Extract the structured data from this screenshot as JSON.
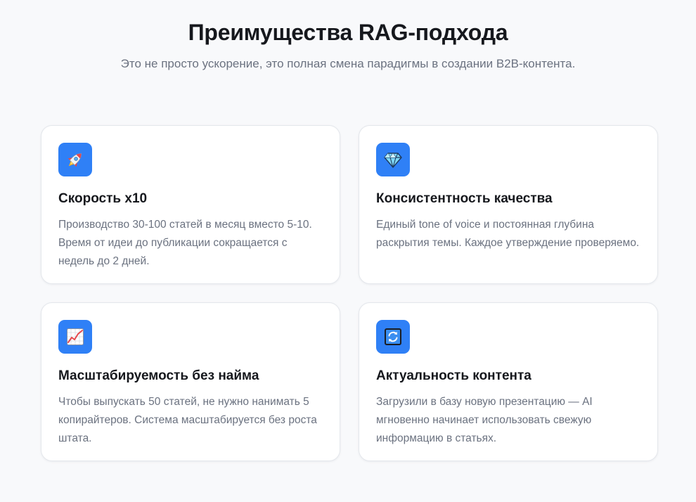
{
  "header": {
    "title": "Преимущества RAG-подхода",
    "subtitle": "Это не просто ускорение, это полная смена парадигмы в создании B2B-контента."
  },
  "colors": {
    "accent": "#2f80f6",
    "background": "#f8f9fb",
    "card": "#ffffff",
    "text_muted": "#6b7280"
  },
  "cards": [
    {
      "icon": "rocket-icon",
      "title": "Скорость x10",
      "text": "Производство 30-100 статей в месяц вместо 5-10. Время от идеи до публикации сокращается с недель до 2 дней."
    },
    {
      "icon": "gem-icon",
      "title": "Консистентность качества",
      "text": "Единый tone of voice и постоянная глубина раскрытия темы. Каждое утверждение проверяемо."
    },
    {
      "icon": "chart-increasing-icon",
      "title": "Масштабируемость без найма",
      "text": "Чтобы выпускать 50 статей, не нужно нанимать 5 копирайтеров. Система масштабируется без роста штата."
    },
    {
      "icon": "refresh-icon",
      "title": "Актуальность контента",
      "text": "Загрузили в базу новую презентацию — AI мгновенно начинает использовать свежую информацию в статьях."
    }
  ]
}
